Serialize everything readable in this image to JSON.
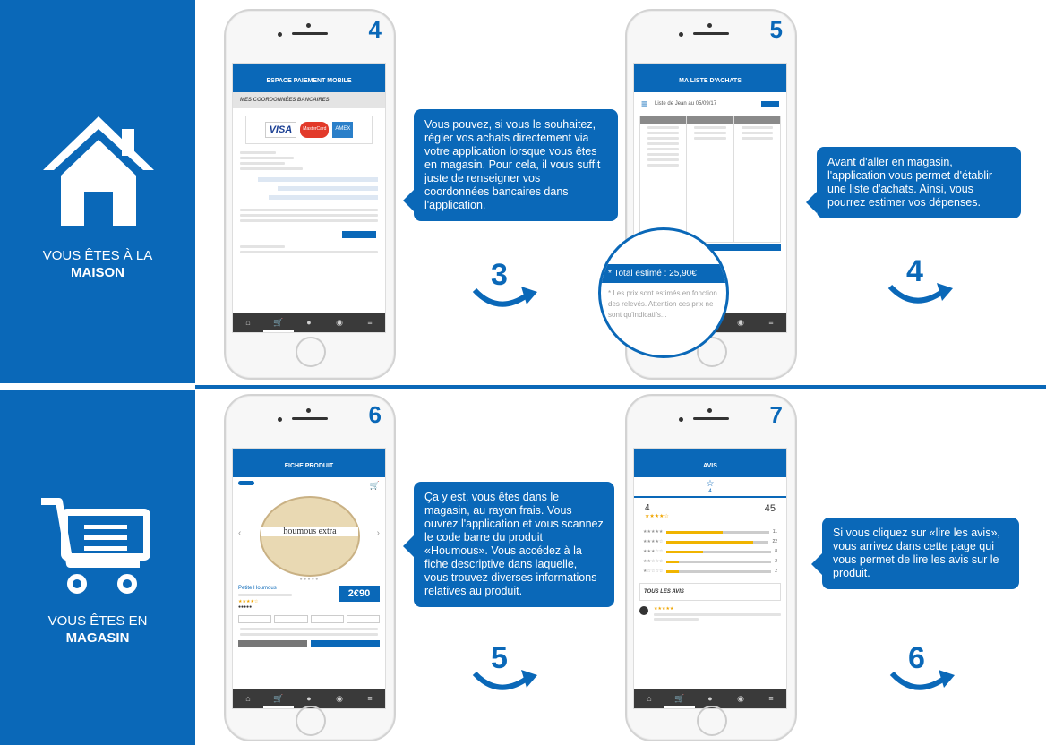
{
  "sections": {
    "home": {
      "line1": "VOUS ÊTES À LA",
      "line2": "MAISON"
    },
    "store": {
      "line1": "VOUS ÊTES EN",
      "line2": "MAGASIN"
    }
  },
  "phones": {
    "p4": {
      "number": "4",
      "title": "ESPACE PAIEMENT MOBILE",
      "heading": "MES COORDONNÉES BANCAIRES",
      "cards": [
        "VISA",
        "MasterCard",
        "AMEX"
      ]
    },
    "p5": {
      "number": "5",
      "title": "MA LISTE D'ACHATS",
      "list_name": "Liste de Jean au 05/09/17",
      "total": "* Total estimé : 25,90€",
      "note": "* Les prix sont estimés en fonction des relevés. Attention ces prix ne sont qu'indicatifs..."
    },
    "p6": {
      "number": "6",
      "title": "FICHE PRODUIT",
      "product_label": "houmous extra",
      "product_name": "Petite Houmous",
      "price": "2€90"
    },
    "p7": {
      "number": "7",
      "title": "AVIS",
      "rating": "4",
      "reviews_count": "45",
      "all_reviews": "TOUS LES AVIS",
      "bars": [
        {
          "stars": "★★★★★",
          "count": "11"
        },
        {
          "stars": "★★★★☆",
          "count": "22"
        },
        {
          "stars": "★★★☆☆",
          "count": "8"
        },
        {
          "stars": "★★☆☆☆",
          "count": "2"
        },
        {
          "stars": "★☆☆☆☆",
          "count": "2"
        }
      ],
      "bar_levels": [
        0.55,
        0.85,
        0.35,
        0.12,
        0.12
      ]
    }
  },
  "bubbles": {
    "b3": "Vous pouvez, si vous le souhaitez, régler vos achats directement via votre application lorsque vous êtes en magasin. Pour cela, il vous suffit juste de renseigner vos coordonnées bancaires dans l'application.",
    "b4": "Avant d'aller en magasin, l'application vous permet d'établir une liste d'achats. Ainsi, vous pourrez estimer vos dépenses.",
    "b5": "Ça y est, vous êtes dans le magasin, au rayon frais. Vous ouvrez l'application et vous scannez le code barre du produit «Houmous». Vous accédez à la fiche descriptive dans laquelle, vous trouvez diverses informations relatives au produit.",
    "b6": "Si vous cliquez sur «lire les avis», vous arrivez dans cette page qui vous permet de lire les avis sur le produit."
  },
  "steps": {
    "s3": "3",
    "s4": "4",
    "s5": "5",
    "s6": "6"
  },
  "tab_icons": [
    "home-icon",
    "cart-icon",
    "user-icon",
    "location-icon",
    "menu-icon"
  ],
  "colors": {
    "brand": "#0a68b8"
  }
}
